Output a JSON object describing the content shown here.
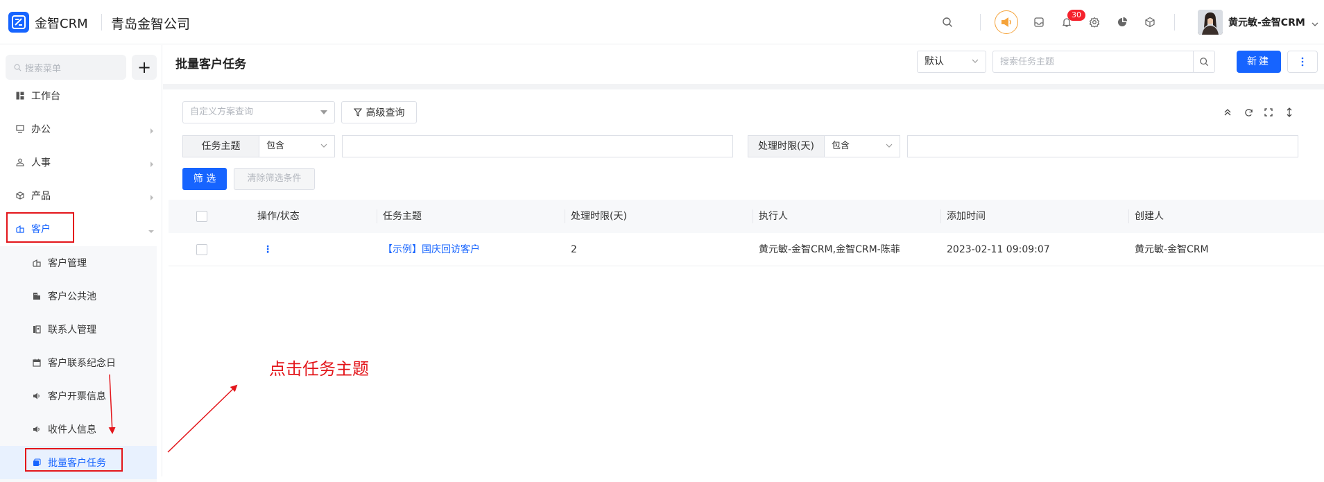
{
  "app": {
    "name": "金智CRM",
    "company": "青岛金智公司"
  },
  "topbar": {
    "notification_count": "30",
    "user_name": "黄元敏-金智CRM"
  },
  "sidebar": {
    "search_placeholder": "搜索菜单",
    "add_symbol": "+",
    "items": [
      {
        "label": "工作台",
        "icon": "dashboard-icon"
      },
      {
        "label": "办公",
        "icon": "monitor-icon"
      },
      {
        "label": "人事",
        "icon": "people-icon"
      },
      {
        "label": "产品",
        "icon": "cube-icon"
      },
      {
        "label": "客户",
        "icon": "customer-icon",
        "active": true
      }
    ],
    "sub_items": [
      {
        "label": "客户管理",
        "icon": "customer-manage-icon"
      },
      {
        "label": "客户公共池",
        "icon": "building-icon"
      },
      {
        "label": "联系人管理",
        "icon": "contacts-icon"
      },
      {
        "label": "客户联系纪念日",
        "icon": "calendar-icon"
      },
      {
        "label": "客户开票信息",
        "icon": "speaker-icon"
      },
      {
        "label": "收件人信息",
        "icon": "speaker-icon"
      },
      {
        "label": "批量客户任务",
        "icon": "task-icon",
        "active": true
      }
    ]
  },
  "page": {
    "title": "批量客户任务",
    "view_select": "默认",
    "search_placeholder": "搜索任务主题",
    "new_button": "新建"
  },
  "filters": {
    "scheme_placeholder": "自定义方案查询",
    "advanced_button": "高级查询",
    "fields": [
      {
        "label": "任务主题",
        "operator": "包含",
        "value": ""
      },
      {
        "label": "处理时限(天)",
        "operator": "包含",
        "value": ""
      }
    ],
    "filter_button": "筛 选",
    "clear_button": "清除筛选条件"
  },
  "table": {
    "columns": [
      "操作/状态",
      "任务主题",
      "处理时限(天)",
      "执行人",
      "添加时间",
      "创建人"
    ],
    "rows": [
      {
        "action": "⋮",
        "subject": "【示例】国庆回访客户",
        "deadline_days": "2",
        "executor": "黄元敏-金智CRM,金智CRM-陈菲",
        "added_time": "2023-02-11 09:09:07",
        "creator": "黄元敏-金智CRM"
      }
    ]
  },
  "annotation": {
    "text": "点击任务主题",
    "color": "#e3151a"
  },
  "colors": {
    "primary": "#1664ff",
    "annotation_red": "#e3151a",
    "badge_red": "#f5222d",
    "megaphone_orange": "#f5a33a"
  }
}
